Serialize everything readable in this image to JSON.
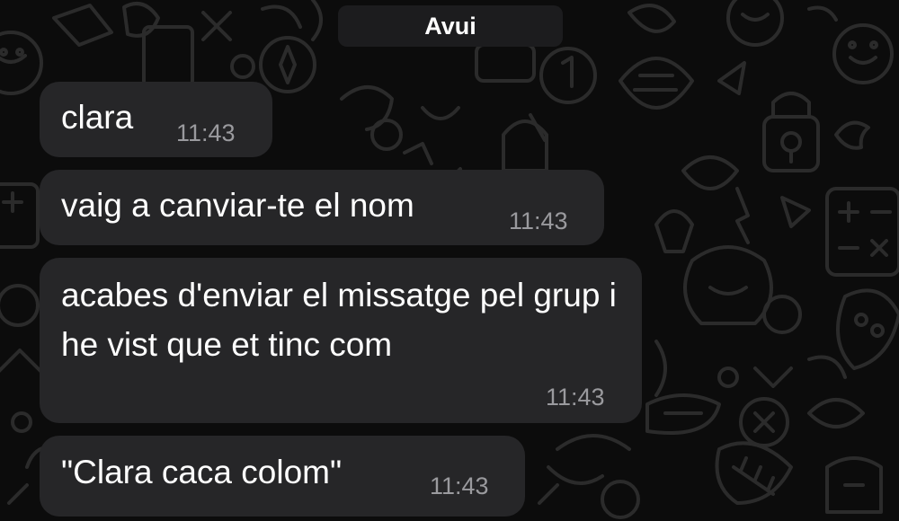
{
  "date_separator": "Avui",
  "messages": [
    {
      "text": "clara",
      "time": "11:43"
    },
    {
      "text": "vaig a canviar-te el nom",
      "time": "11:43"
    },
    {
      "text": "acabes d'enviar el missatge pel grup i he vist que et tinc com",
      "time": "11:43"
    },
    {
      "text": "\"Clara caca colom\"",
      "time": "11:43"
    }
  ],
  "colors": {
    "background": "#0c0c0c",
    "bubble": "#262628",
    "text": "#ffffff",
    "timestamp": "#9a9a9e"
  }
}
